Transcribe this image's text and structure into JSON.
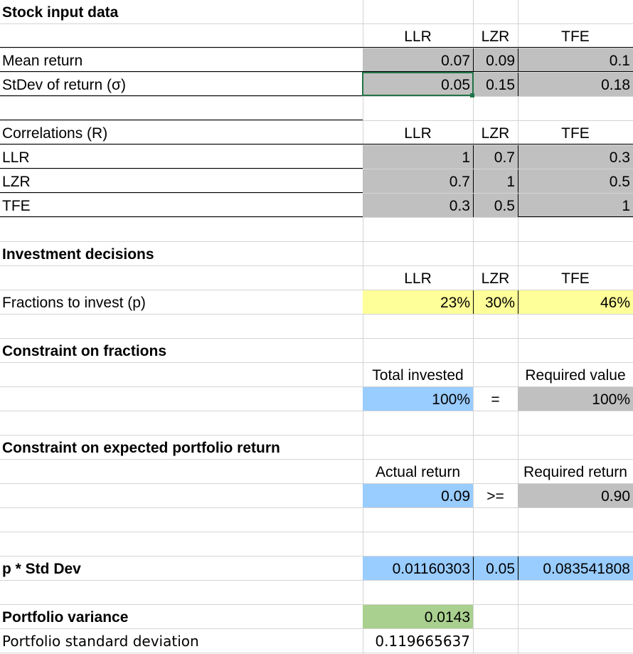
{
  "sections": {
    "stock_input": "Stock input data",
    "investment": "Investment decisions",
    "constraint_fractions": "Constraint on fractions",
    "constraint_return": "Constraint on expected portfolio return"
  },
  "stocks": [
    "LLR",
    "LZR",
    "TFE"
  ],
  "stock_input": {
    "mean_label": "Mean return",
    "mean": [
      "0.07",
      "0.09",
      "0.1"
    ],
    "stdev_label": "StDev of return (σ)",
    "stdev": [
      "0.05",
      "0.15",
      "0.18"
    ]
  },
  "correlations": {
    "header": "Correlations (R)",
    "rows": [
      {
        "label": "LLR",
        "values": [
          "1",
          "0.7",
          "0.3"
        ]
      },
      {
        "label": "LZR",
        "values": [
          "0.7",
          "1",
          "0.5"
        ]
      },
      {
        "label": "TFE",
        "values": [
          "0.3",
          "0.5",
          "1"
        ]
      }
    ]
  },
  "investment": {
    "fractions_label": "Fractions to invest (p)",
    "fractions": [
      "23%",
      "30%",
      "46%"
    ]
  },
  "constraint_fractions": {
    "total_label": "Total invested",
    "required_label": "Required value",
    "total": "100%",
    "operator": "=",
    "required": "100%"
  },
  "constraint_return": {
    "actual_label": "Actual return",
    "required_label": "Required return",
    "actual": "0.09",
    "operator": ">=",
    "required": "0.90"
  },
  "p_std": {
    "label": "p * Std Dev",
    "values": [
      "0.01160303",
      "0.05",
      "0.083541808"
    ]
  },
  "portfolio": {
    "variance_label": "Portfolio variance",
    "variance": "0.0143",
    "std_label": "Portfolio standard deviation",
    "std": "0.119665637"
  },
  "colors": {
    "input_gray": "#c0c0c0",
    "decision_yellow": "#ffff99",
    "calc_blue": "#99ccff",
    "result_green": "#a9d08e",
    "selection": "#217346"
  }
}
